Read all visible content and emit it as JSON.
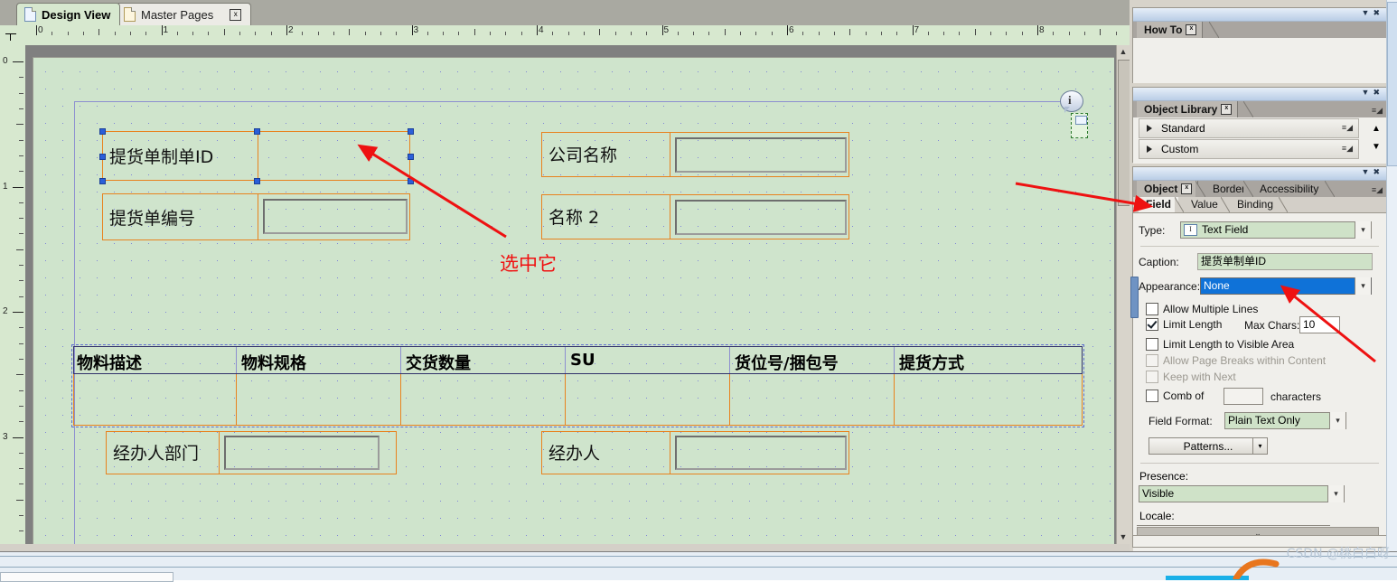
{
  "editor": {
    "tabs": [
      {
        "label": "Design View",
        "icon": "page-icon",
        "active": true,
        "closable": false
      },
      {
        "label": "Master Pages",
        "icon": "page-icon",
        "active": false,
        "closable": true,
        "close_label": "x"
      }
    ],
    "ruler": {
      "horizontal_labels": [
        "0",
        "1",
        "2",
        "3",
        "4",
        "5",
        "6",
        "7",
        "8"
      ],
      "vertical_labels": [
        "0",
        "1",
        "2",
        "3"
      ],
      "units": "inches"
    },
    "annotation": {
      "text": "选中它",
      "color": "#f01010"
    },
    "form": {
      "fields_left": [
        {
          "caption": "提货单制单ID",
          "selected": true,
          "has_input_box": false
        },
        {
          "caption": "提货单编号",
          "selected": false,
          "has_input_box": true
        }
      ],
      "fields_right": [
        {
          "caption": "公司名称",
          "selected": false,
          "has_input_box": true
        },
        {
          "caption": "名称 2",
          "selected": false,
          "has_input_box": true
        }
      ],
      "table_headers": [
        "物料描述",
        "物料规格",
        "交货数量",
        "SU",
        "货位号/捆包号",
        "提货方式"
      ],
      "footer_fields": [
        {
          "caption": "经办人部门",
          "has_input_box": true
        },
        {
          "caption": "经办人",
          "has_input_box": true
        }
      ]
    }
  },
  "right_panels": {
    "how_to": {
      "tab_label": "How To",
      "close_label": "x",
      "body": ""
    },
    "object_library": {
      "tab_label": "Object Library",
      "close_label": "x",
      "groups": [
        {
          "label": "Standard"
        },
        {
          "label": "Custom"
        }
      ]
    },
    "object": {
      "tabs": [
        {
          "label": "Object",
          "selected": true,
          "closable": true,
          "close_label": "x"
        },
        {
          "label": "Border",
          "selected": false
        },
        {
          "label": "Accessibility",
          "selected": false
        }
      ],
      "subtabs": [
        {
          "label": "Field",
          "selected": true
        },
        {
          "label": "Value",
          "selected": false
        },
        {
          "label": "Binding",
          "selected": false
        }
      ],
      "type": {
        "label": "Type:",
        "value": "Text Field",
        "icon": "text-field-icon"
      },
      "caption": {
        "label": "Caption:",
        "value": "提货单制单ID"
      },
      "appearance": {
        "label": "Appearance:",
        "value": "None",
        "highlighted": true,
        "highlight_color": "#0f72d8"
      },
      "checkboxes": [
        {
          "label": "Allow Multiple Lines",
          "checked": false,
          "enabled": true
        },
        {
          "label": "Limit Length",
          "checked": true,
          "enabled": true
        },
        {
          "label": "Limit Length to Visible Area",
          "checked": false,
          "enabled": true
        },
        {
          "label": "Allow Page Breaks within Content",
          "checked": false,
          "enabled": false
        },
        {
          "label": "Keep with Next",
          "checked": false,
          "enabled": false
        }
      ],
      "max_chars": {
        "label": "Max Chars:",
        "value": "10"
      },
      "comb": {
        "label": "Comb of",
        "value": "",
        "suffix": "characters",
        "checked": false
      },
      "field_format": {
        "label": "Field Format:",
        "value": "Plain Text Only"
      },
      "patterns_button": {
        "label": "Patterns..."
      },
      "presence": {
        "label": "Presence:",
        "value": "Visible"
      },
      "locale": {
        "label": "Locale:",
        "value": ""
      }
    }
  },
  "watermark": {
    "text": "CSDN @桃白白呀"
  }
}
